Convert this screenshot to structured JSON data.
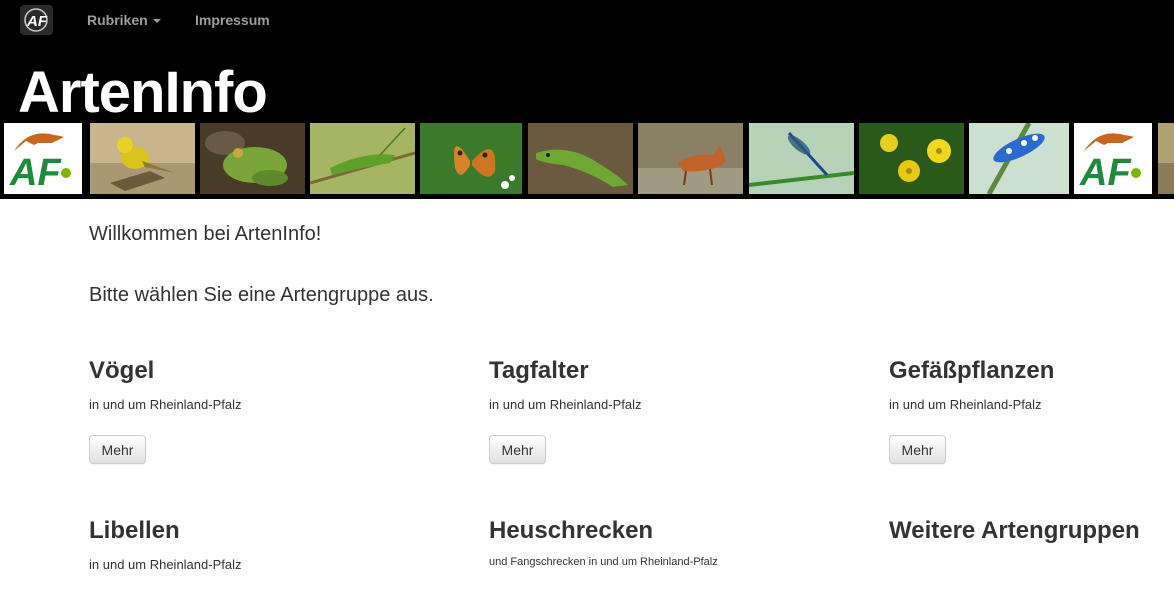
{
  "nav": {
    "logo_text": "AF",
    "items": [
      {
        "label": "Rubriken",
        "has_dropdown": true
      },
      {
        "label": "Impressum",
        "has_dropdown": false
      }
    ]
  },
  "header": {
    "title": "ArtenInfo",
    "banner_images": [
      {
        "name": "af-logo",
        "subject": "AF-Logo"
      },
      {
        "name": "goldammer",
        "subject": "yellow bird on branch"
      },
      {
        "name": "frosch",
        "subject": "green frog"
      },
      {
        "name": "heuschrecke",
        "subject": "green grasshopper"
      },
      {
        "name": "tagfalter",
        "subject": "orange butterfly"
      },
      {
        "name": "eidechse",
        "subject": "green lizard"
      },
      {
        "name": "fuchs",
        "subject": "red fox"
      },
      {
        "name": "libelle",
        "subject": "blue damselfly"
      },
      {
        "name": "blumen",
        "subject": "yellow flowers"
      },
      {
        "name": "kaefer",
        "subject": "blue spotted beetle"
      },
      {
        "name": "af-logo-2",
        "subject": "AF-Logo"
      },
      {
        "name": "partial",
        "subject": "partial image"
      }
    ]
  },
  "main": {
    "welcome": "Willkommen bei ArtenInfo!",
    "prompt": "Bitte wählen Sie eine Artengruppe aus.",
    "groups": [
      {
        "title": "Vögel",
        "subtitle": "in und um Rheinland-Pfalz",
        "button": "Mehr"
      },
      {
        "title": "Tagfalter",
        "subtitle": "in und um Rheinland-Pfalz",
        "button": "Mehr"
      },
      {
        "title": "Gefäßpflanzen",
        "subtitle": "in und um Rheinland-Pfalz",
        "button": "Mehr"
      },
      {
        "title": "Libellen",
        "subtitle": "in und um Rheinland-Pfalz"
      },
      {
        "title": "Heuschrecken",
        "subtitle": "und Fangschrecken in und um Rheinland-Pfalz"
      },
      {
        "title": "Weitere Artengruppen"
      }
    ]
  },
  "colors": {
    "header_bg": "#000000",
    "nav_text": "#9d9d9d",
    "title_text": "#ffffff",
    "body_text": "#333333"
  }
}
